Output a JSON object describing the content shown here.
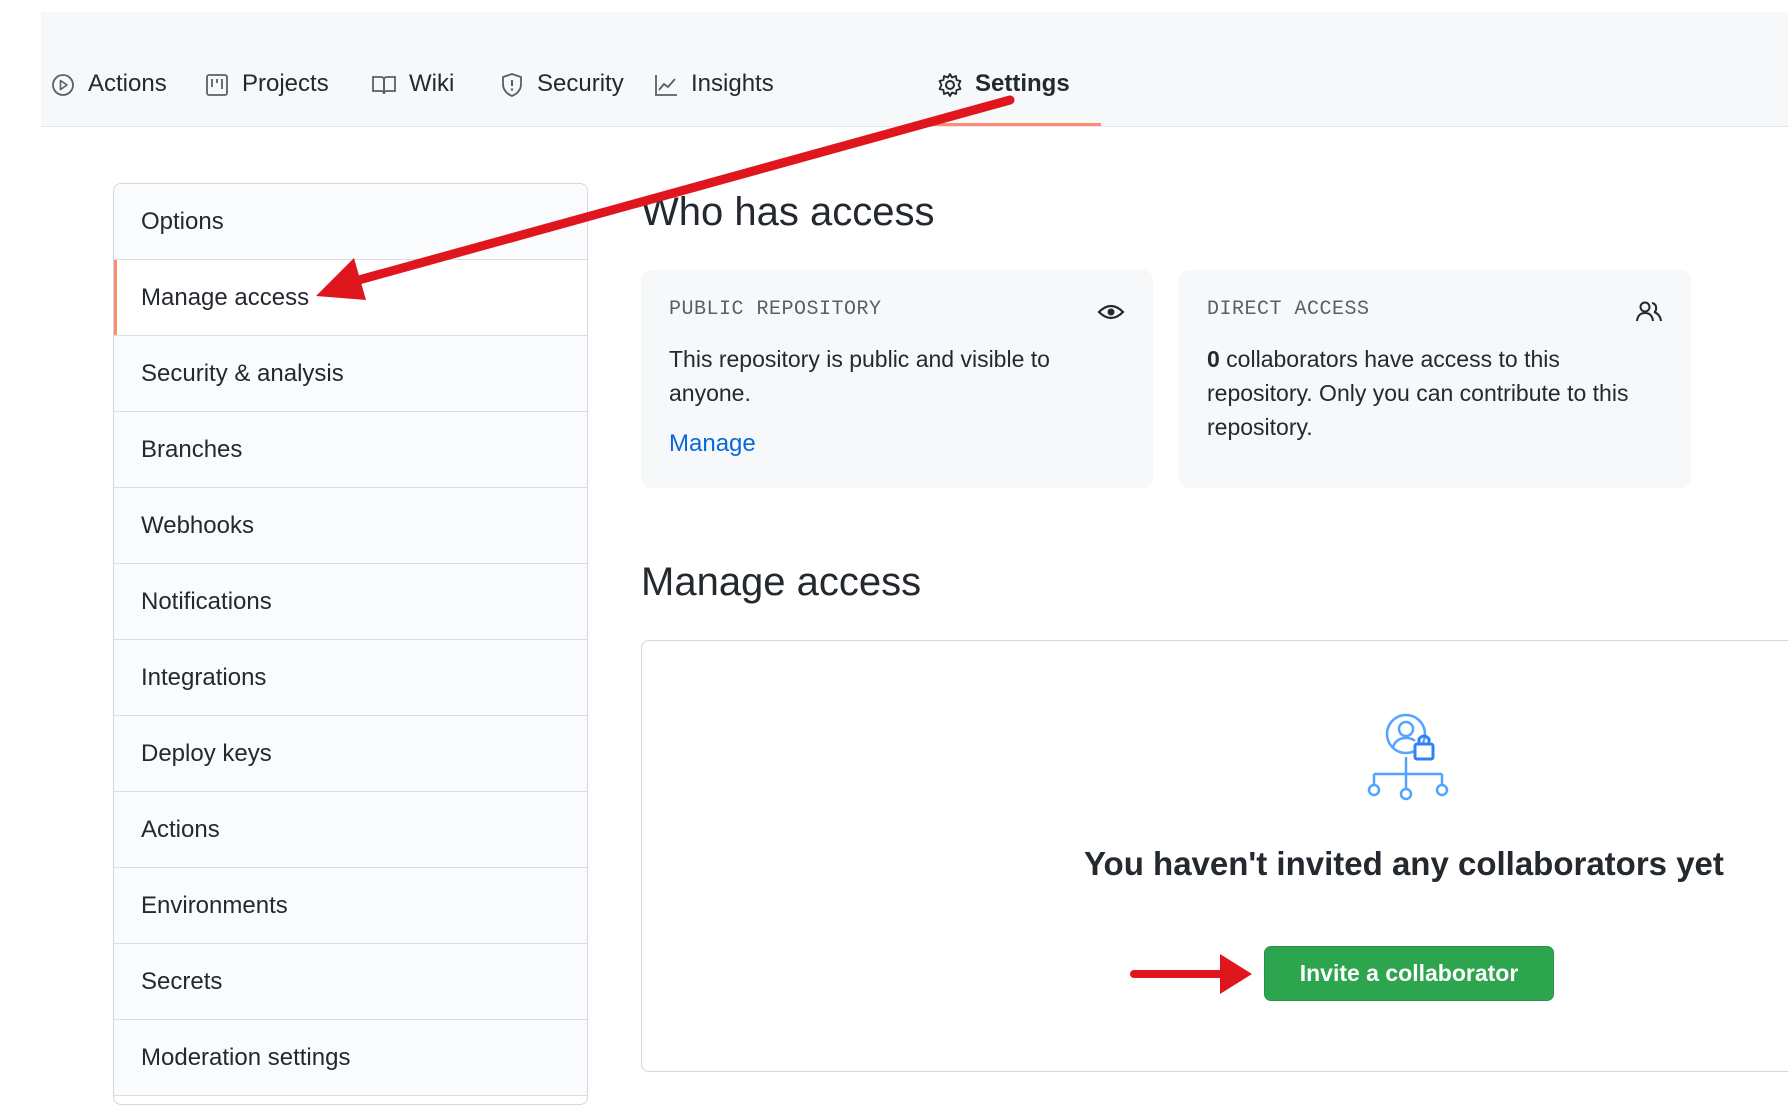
{
  "nav": {
    "tabs": [
      {
        "label": "Actions",
        "icon": "play-icon"
      },
      {
        "label": "Projects",
        "icon": "project-icon"
      },
      {
        "label": "Wiki",
        "icon": "book-icon"
      },
      {
        "label": "Security",
        "icon": "shield-icon"
      },
      {
        "label": "Insights",
        "icon": "graph-icon"
      },
      {
        "label": "Settings",
        "icon": "gear-icon",
        "selected": true
      }
    ]
  },
  "sidebar": {
    "items": [
      {
        "label": "Options"
      },
      {
        "label": "Manage access",
        "active": true
      },
      {
        "label": "Security & analysis"
      },
      {
        "label": "Branches"
      },
      {
        "label": "Webhooks"
      },
      {
        "label": "Notifications"
      },
      {
        "label": "Integrations"
      },
      {
        "label": "Deploy keys"
      },
      {
        "label": "Actions"
      },
      {
        "label": "Environments"
      },
      {
        "label": "Secrets"
      },
      {
        "label": "Moderation settings"
      }
    ]
  },
  "main": {
    "who_has_access_title": "Who has access",
    "public_card": {
      "label": "PUBLIC REPOSITORY",
      "icon": "eye-icon",
      "text": "This repository is public and visible to anyone.",
      "link": "Manage"
    },
    "direct_card": {
      "label": "DIRECT ACCESS",
      "icon": "people-icon",
      "count": "0",
      "text": " collaborators have access to this repository. Only you can contribute to this repository."
    },
    "manage_access_title": "Manage access",
    "empty_state": {
      "icon": "collaborator-lock-icon",
      "title": "You haven't invited any collaborators yet",
      "button": "Invite a collaborator"
    }
  },
  "colors": {
    "accent_underline": "#fd8c73",
    "link": "#0969da",
    "primary_button": "#2da44e",
    "annotation_arrow": "#e0161f"
  }
}
